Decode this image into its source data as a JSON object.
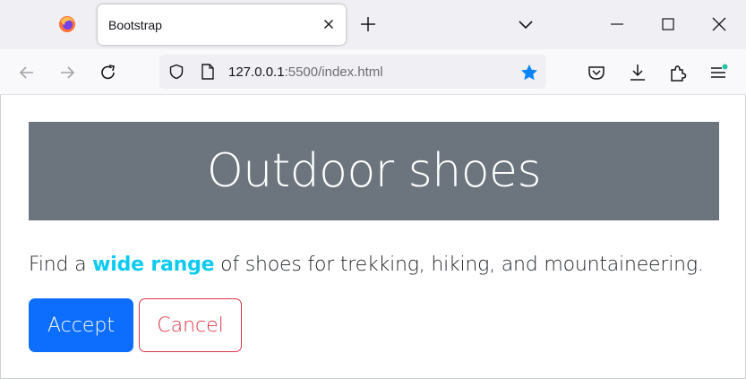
{
  "browser": {
    "tab": {
      "title": "Bootstrap"
    },
    "url": {
      "host": "127.0.0.1",
      "rest": ":5500/index.html"
    },
    "colors": {
      "star": "#0a84ff",
      "pocket_dot": "#2ac3a2"
    }
  },
  "page": {
    "banner": {
      "heading": "Outdoor shoes",
      "background": "#6c757d"
    },
    "lead": {
      "before": "Find a ",
      "highlight": "wide range",
      "after": " of shoes for trekking, hiking, and mountaineering."
    },
    "buttons": {
      "accept_label": "Accept",
      "cancel_label": "Cancel"
    },
    "colors": {
      "primary": "#0d6efd",
      "danger": "#dc3545",
      "info": "#0dcaf0"
    }
  }
}
